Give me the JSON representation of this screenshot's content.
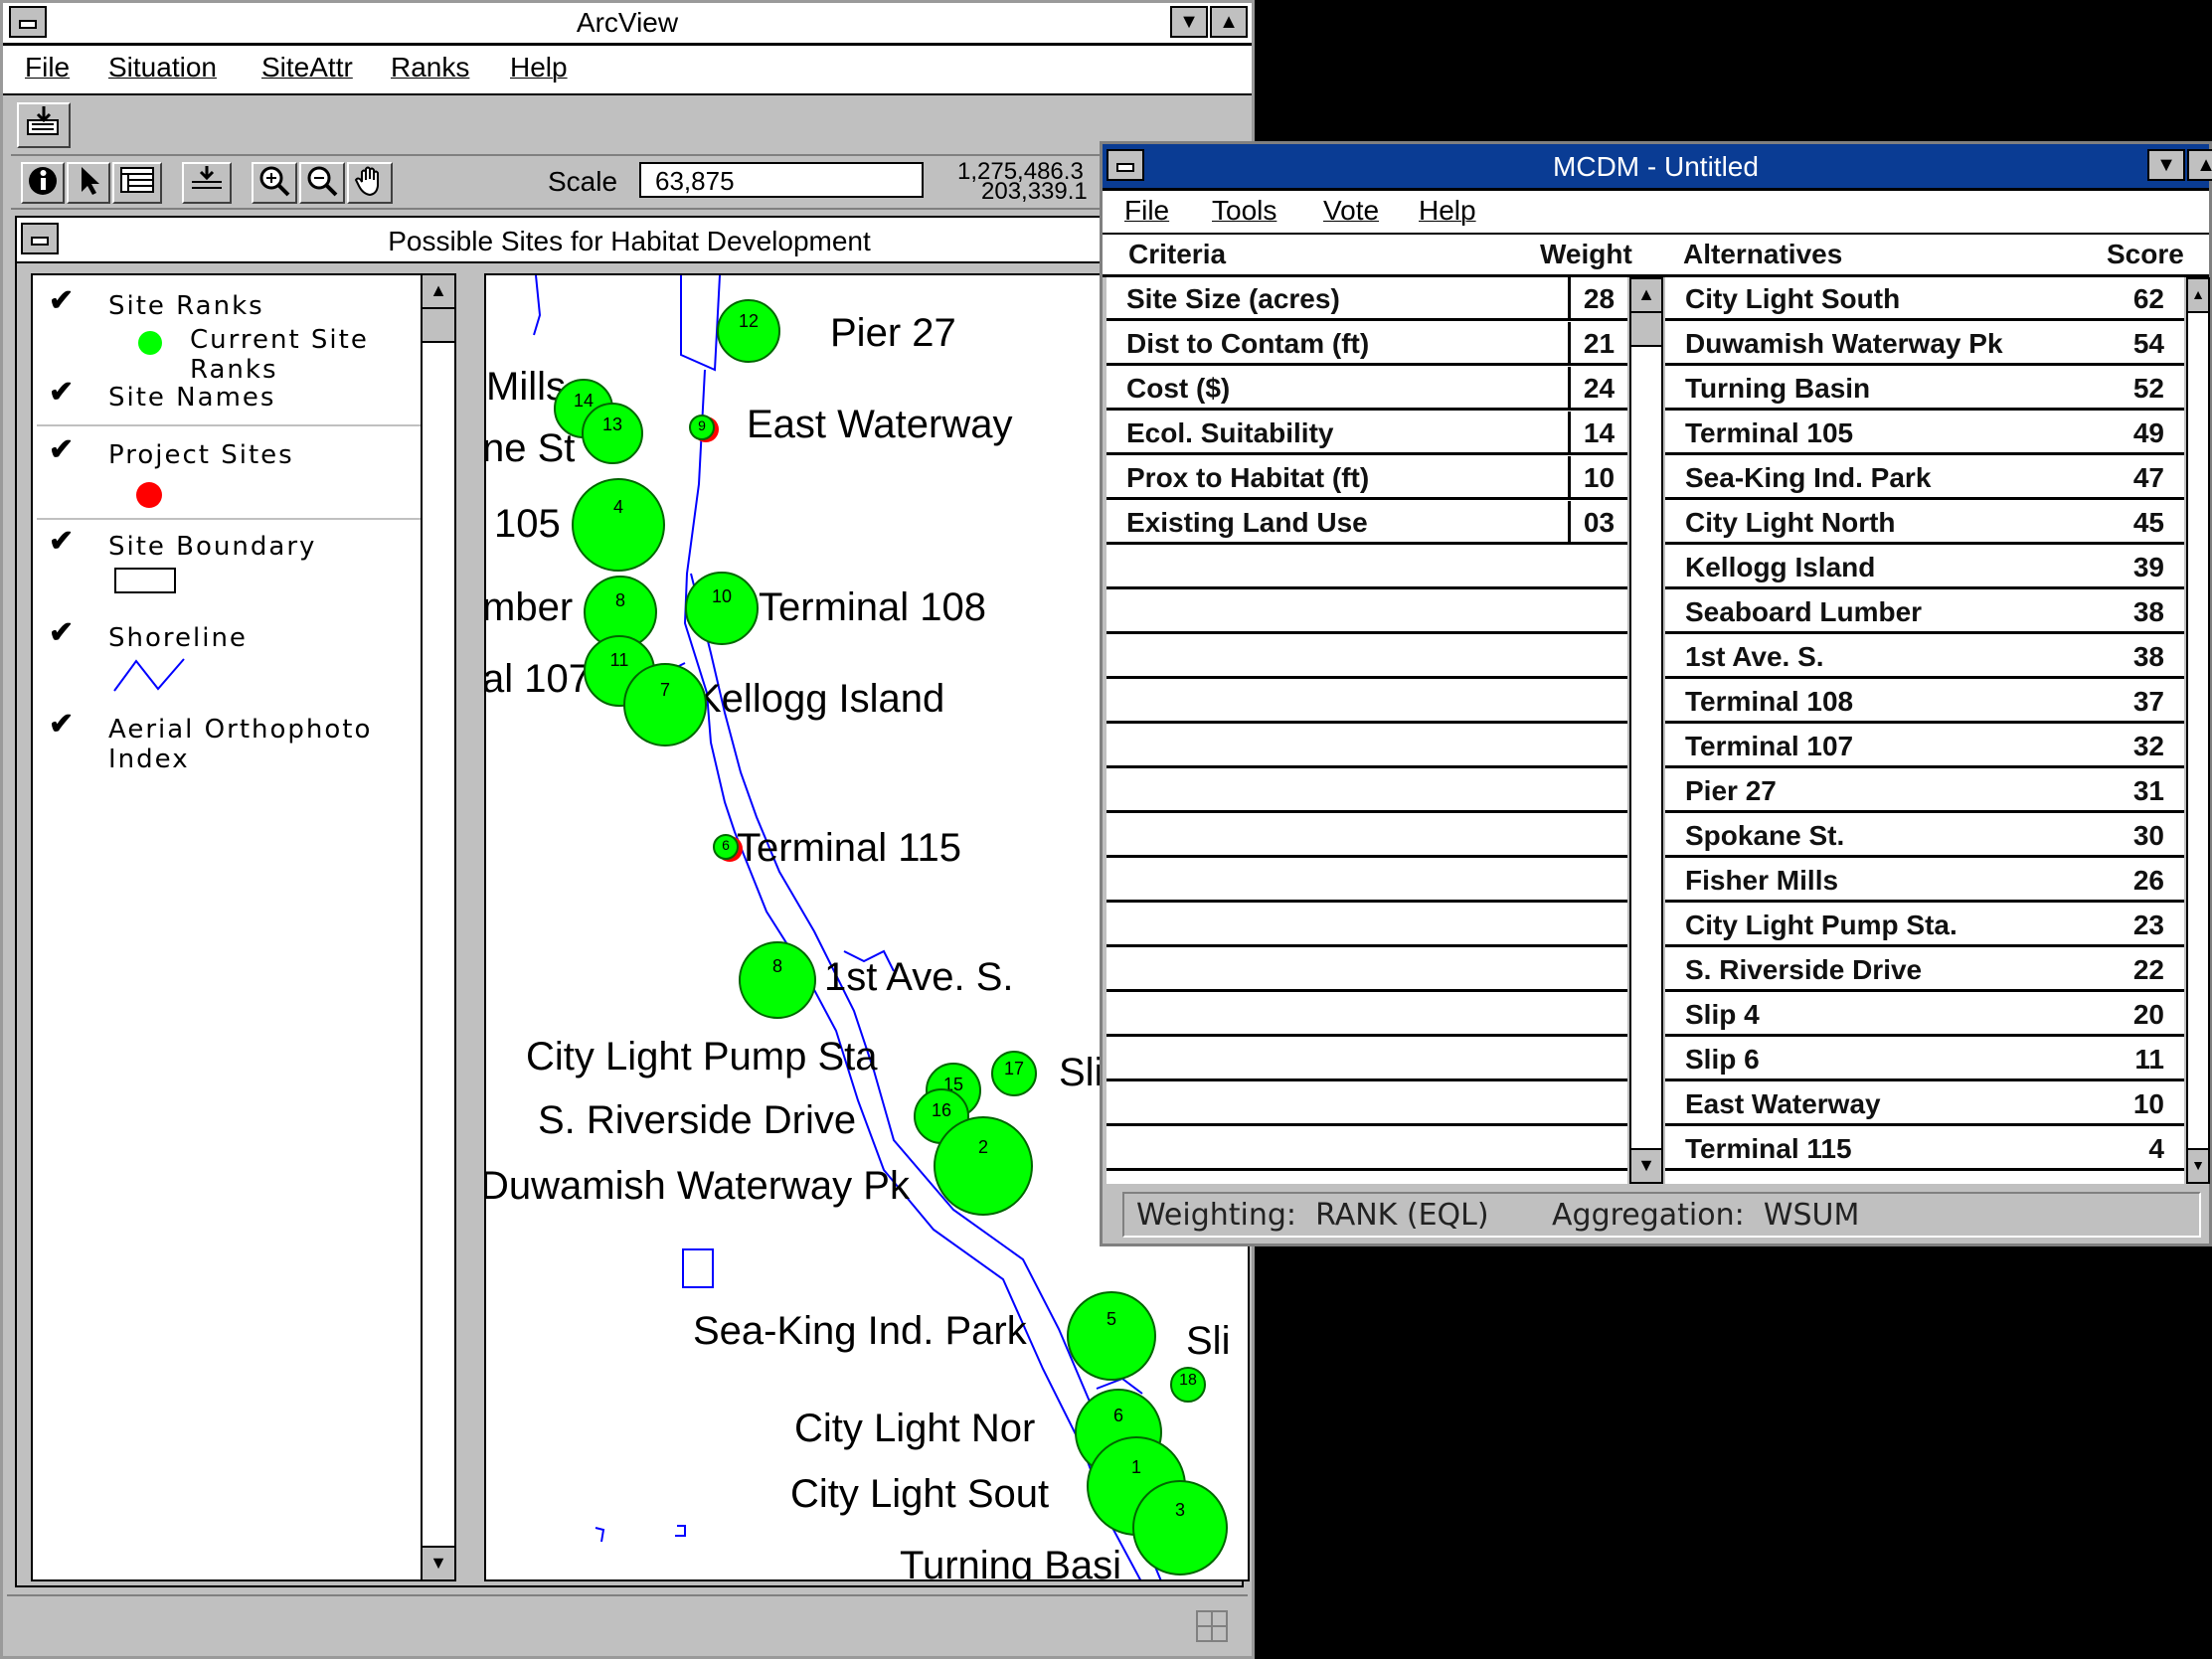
{
  "arcview": {
    "title": "ArcView",
    "menus": [
      "File",
      "Situation",
      "SiteAttr",
      "Ranks",
      "Help"
    ],
    "scale_label": "Scale",
    "scale_value": "63,875",
    "coord_x": "1,275,486.3",
    "coord_y": "203,339.1",
    "view_title": "Possible Sites for Habitat Development",
    "legend": [
      {
        "label": "Site Ranks",
        "sub": "Current Site Ranks",
        "symbol": "green-dot"
      },
      {
        "label": "Site Names"
      },
      {
        "label": "Project Sites",
        "symbol": "red-dot"
      },
      {
        "label": "Site Boundary",
        "symbol": "rectangle"
      },
      {
        "label": "Shoreline",
        "symbol": "zigzag"
      },
      {
        "label": "Aerial Orthophoto Index"
      }
    ],
    "map_labels": [
      "Pier 27",
      "Mills",
      "ne St",
      "East Waterway",
      "105",
      "mber",
      "Terminal 108",
      "al 107",
      "Kellogg Island",
      "Terminal 115",
      "1st Ave. S.",
      "City Light Pump Sta",
      "Sli",
      "S. Riverside Drive",
      "Duwamish Waterway Pk",
      "Sea-King Ind. Park",
      "Sli",
      "City Light Nor",
      "City Light Sout",
      "Turning Basi"
    ],
    "site_numbers": [
      "12",
      "14",
      "13",
      "9",
      "4",
      "8",
      "10",
      "11",
      "7",
      "8",
      "6",
      "15",
      "16",
      "17",
      "2",
      "5",
      "18",
      "6",
      "1",
      "3"
    ]
  },
  "mcdm": {
    "title": "MCDM - Untitled",
    "menus": [
      "File",
      "Tools",
      "Vote",
      "Help"
    ],
    "criteria_header": "Criteria",
    "weight_header": "Weight",
    "alternatives_header": "Alternatives",
    "score_header": "Score",
    "criteria": [
      {
        "name": "Site Size (acres)",
        "weight": "28"
      },
      {
        "name": "Dist to Contam (ft)",
        "weight": "21"
      },
      {
        "name": "Cost ($)",
        "weight": "24"
      },
      {
        "name": "Ecol. Suitability",
        "weight": "14"
      },
      {
        "name": "Prox to Habitat (ft)",
        "weight": "10"
      },
      {
        "name": "Existing Land Use",
        "weight": "03"
      }
    ],
    "alternatives": [
      {
        "name": "City Light South",
        "score": "62"
      },
      {
        "name": "Duwamish Waterway Pk",
        "score": "54"
      },
      {
        "name": "Turning Basin",
        "score": "52"
      },
      {
        "name": "Terminal 105",
        "score": "49"
      },
      {
        "name": "Sea-King Ind. Park",
        "score": "47"
      },
      {
        "name": "City Light North",
        "score": "45"
      },
      {
        "name": "Kellogg Island",
        "score": "39"
      },
      {
        "name": "Seaboard Lumber",
        "score": "38"
      },
      {
        "name": "1st Ave. S.",
        "score": "38"
      },
      {
        "name": "Terminal 108",
        "score": "37"
      },
      {
        "name": "Terminal 107",
        "score": "32"
      },
      {
        "name": "Pier 27",
        "score": "31"
      },
      {
        "name": "Spokane St.",
        "score": "30"
      },
      {
        "name": "Fisher Mills",
        "score": "26"
      },
      {
        "name": "City Light Pump Sta.",
        "score": "23"
      },
      {
        "name": "S. Riverside Drive",
        "score": "22"
      },
      {
        "name": "Slip 4",
        "score": "20"
      },
      {
        "name": "Slip 6",
        "score": "11"
      },
      {
        "name": "East Waterway",
        "score": "10"
      },
      {
        "name": "Terminal 115",
        "score": "4"
      }
    ],
    "status_weighting": "Weighting:  RANK (EQL)",
    "status_aggregation": "Aggregation:  WSUM"
  }
}
